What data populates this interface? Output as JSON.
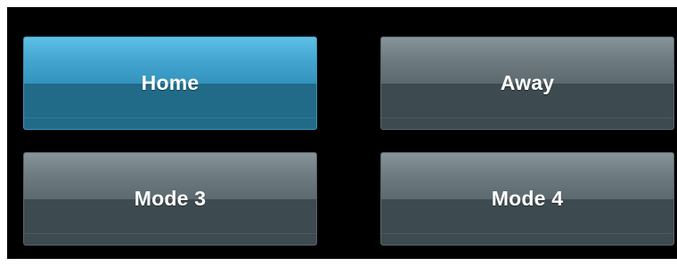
{
  "modes": {
    "active": "home",
    "buttons": [
      {
        "id": "home",
        "label": "Home",
        "state": "active"
      },
      {
        "id": "away",
        "label": "Away",
        "state": "inactive"
      },
      {
        "id": "mode_3",
        "label": "Mode 3",
        "state": "inactive"
      },
      {
        "id": "mode_4",
        "label": "Mode 4",
        "state": "inactive"
      }
    ]
  },
  "colors": {
    "background": "#000000",
    "active_top": "#5fc0e6",
    "active_bottom": "#216a88",
    "inactive_top": "#87949a",
    "inactive_bottom": "#3d4a4f",
    "label": "#ffffff"
  }
}
